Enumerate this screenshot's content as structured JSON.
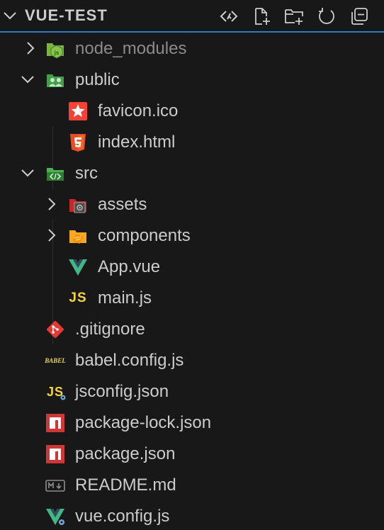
{
  "explorer": {
    "title": "VUE-TEST",
    "actions": [
      {
        "name": "refresh-remote-icon",
        "label": ""
      },
      {
        "name": "new-file-icon",
        "label": ""
      },
      {
        "name": "new-folder-icon",
        "label": ""
      },
      {
        "name": "refresh-icon",
        "label": ""
      },
      {
        "name": "collapse-all-icon",
        "label": ""
      }
    ],
    "accent_color": "#2b79d0"
  },
  "tree": {
    "items": [
      {
        "label": "node_modules",
        "type": "folder",
        "state": "collapsed",
        "icon": "nodejs-folder-icon",
        "dim": true
      },
      {
        "label": "public",
        "type": "folder",
        "state": "expanded",
        "icon": "public-folder-icon"
      },
      {
        "label": "favicon.ico",
        "type": "file",
        "icon": "favicon-icon"
      },
      {
        "label": "index.html",
        "type": "file",
        "icon": "html5-icon"
      },
      {
        "label": "src",
        "type": "folder",
        "state": "expanded",
        "icon": "src-folder-icon"
      },
      {
        "label": "assets",
        "type": "folder",
        "state": "collapsed",
        "icon": "assets-folder-icon"
      },
      {
        "label": "components",
        "type": "folder",
        "state": "collapsed",
        "icon": "components-folder-icon"
      },
      {
        "label": "App.vue",
        "type": "file",
        "icon": "vue-icon"
      },
      {
        "label": "main.js",
        "type": "file",
        "icon": "javascript-icon"
      },
      {
        "label": ".gitignore",
        "type": "file",
        "icon": "git-icon"
      },
      {
        "label": "babel.config.js",
        "type": "file",
        "icon": "babel-icon"
      },
      {
        "label": "jsconfig.json",
        "type": "file",
        "icon": "jsconfig-icon"
      },
      {
        "label": "package-lock.json",
        "type": "file",
        "icon": "npm-icon"
      },
      {
        "label": "package.json",
        "type": "file",
        "icon": "npm-icon"
      },
      {
        "label": "README.md",
        "type": "file",
        "icon": "markdown-icon"
      },
      {
        "label": "vue.config.js",
        "type": "file",
        "icon": "vue-config-icon"
      }
    ],
    "icon_texts": {
      "js": "JS",
      "babel": "BABEL"
    }
  }
}
